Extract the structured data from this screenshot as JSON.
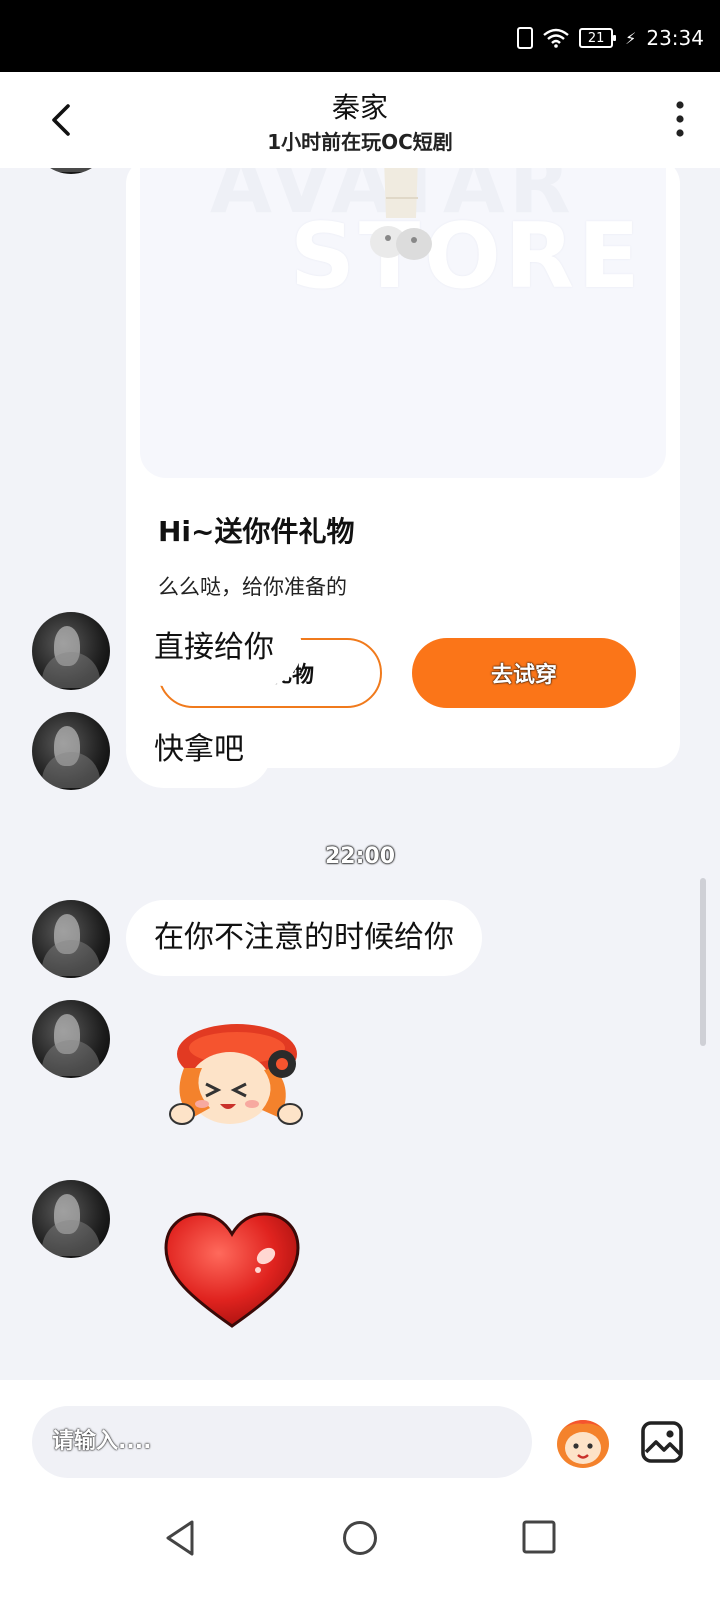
{
  "status_bar": {
    "battery": "21",
    "time": "23:34"
  },
  "header": {
    "title": "秦家",
    "subtitle": "1小时前在玩OC短剧"
  },
  "gift_card": {
    "image_text_1": "AVATAR",
    "image_text_2": "STORE",
    "title": "Hi~送你件礼物",
    "description": "么么哒，给你准备的",
    "return_gift_label": "回赠礼物",
    "try_on_label": "去试穿"
  },
  "messages": [
    {
      "text": "直接给你"
    },
    {
      "text": "快拿吧"
    },
    {
      "text": "在你不注意的时候给你"
    }
  ],
  "timestamp": "22:00",
  "input": {
    "placeholder": "请输入...."
  },
  "colors": {
    "accent": "#fb7518",
    "background": "#f2f3f8",
    "bubble": "#ffffff"
  }
}
